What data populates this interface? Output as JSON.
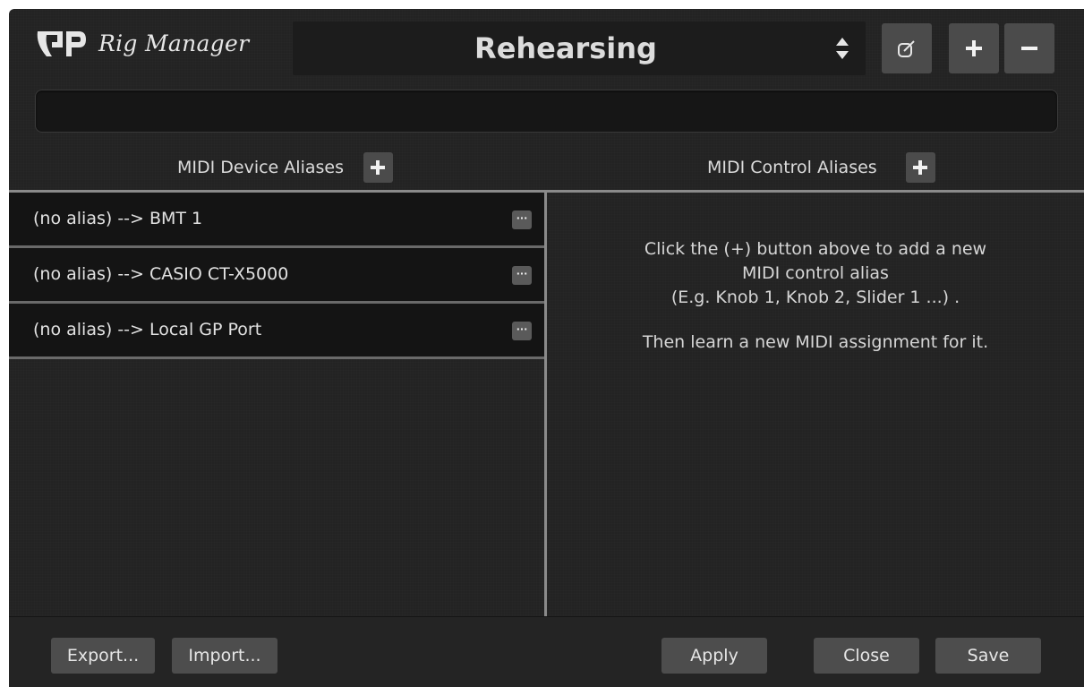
{
  "app": {
    "logo_mark": "GP",
    "title": "Rig Manager"
  },
  "rig_selector": {
    "value": "Rehearsing",
    "icon": "up-down-arrows-icon"
  },
  "toolbar": {
    "edit_icon": "edit-icon",
    "add_icon": "plus-icon",
    "remove_icon": "minus-icon"
  },
  "status_bar": {
    "text": ""
  },
  "midi_device_aliases": {
    "title": "MIDI Device Aliases",
    "add_icon": "plus-icon",
    "items": [
      {
        "label": "(no alias) --> BMT 1",
        "more": "···"
      },
      {
        "label": "(no alias) --> CASIO CT-X5000",
        "more": "···"
      },
      {
        "label": "(no alias) --> Local GP Port",
        "more": "···"
      }
    ]
  },
  "midi_control_aliases": {
    "title": "MIDI Control Aliases",
    "add_icon": "plus-icon",
    "help_lines": [
      "Click the (+) button above to add a new",
      "MIDI control alias",
      "(E.g. Knob 1, Knob 2, Slider 1 ...) .",
      "Then learn a new MIDI assignment for it."
    ]
  },
  "footer": {
    "export_label": "Export...",
    "import_label": "Import...",
    "apply_label": "Apply",
    "close_label": "Close",
    "save_label": "Save"
  },
  "colors": {
    "window_bg": "#232323",
    "list_row_bg": "#141414",
    "button_bg": "#4b4b4b",
    "divider": "#8a8a8a"
  }
}
